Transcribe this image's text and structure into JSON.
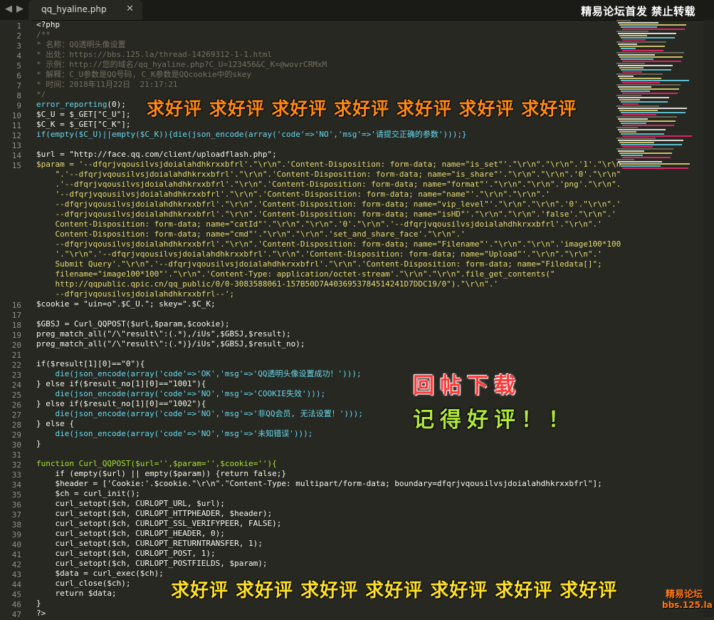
{
  "tabbar": {
    "back_icon": "◀",
    "forward_icon": "▶",
    "tab_title": "qq_hyaline.php",
    "close_icon": "✕"
  },
  "banner": "精易论坛首发 禁止转载",
  "gutter": [
    "1",
    "2",
    "3",
    "4",
    "5",
    "6",
    "7",
    "8",
    "9",
    "10",
    "11",
    "12",
    "13",
    "14",
    "15",
    "16",
    "17",
    "18",
    "19",
    "20",
    "21",
    "22",
    "23",
    "24",
    "25",
    "26",
    "27",
    "28",
    "29",
    "30",
    "31",
    "32",
    "33",
    "34",
    "35",
    "36",
    "37",
    "38",
    "39",
    "40",
    "41",
    "42",
    "43",
    "44",
    "45",
    "46",
    "47"
  ],
  "code": {
    "l1": "<?php",
    "l2": "/**",
    "l3": "* 名称：QQ透明头像设置",
    "l4": "* 出处：https://bbs.125.la/thread-14269312-1-1.html",
    "l5": "* 示例：http://您的域名/qq_hyaline.php?C_U=123456&C_K=@wovrCRMxM",
    "l6": "* 解释：C_U参数是QQ号码, C_K参数是QQcookie中的skey",
    "l7": "* 时间：2018年11月22日  21:17:21",
    "l8": "*/",
    "l9_fn": "error_reporting",
    "l9_rest": "(0);",
    "l10": "$C_U = $_GET[\"C_U\"];",
    "l11": "$C_K = $_GET[\"C_K\"];",
    "l12a": "if(empty($C_U)||empty($C_K)){die(json_encode(array('code'=>'NO','msg'=>'请提交正确的参数')));}",
    "l14": "$url = \"http://face.qq.com/client/uploadflash.php\";",
    "l15_1": "$param = '--dfqrjvqousilvsjdoialahdhkrxxbfrl'.\"\\r\\n\".'Content-Disposition: form-data; name=\"is_set\"'.\"\\r\\n\".\"\\r\\n\".'1'.\"\\r\\n",
    "l15_2": "    \".'--dfqrjvqousilvsjdoialahdhkrxxbfrl'.\"\\r\\n\".'Content-Disposition: form-data; name=\"is_share\"'.\"\\r\\n\".\"\\r\\n\".'0'.\"\\r\\n\"",
    "l15_3": "    .'--dfqrjvqousilvsjdoialahdhkrxxbfrl'.\"\\r\\n\".'Content-Disposition: form-data; name=\"format\"'.\"\\r\\n\".\"\\r\\n\".'png'.\"\\r\\n\".",
    "l15_4": "    '--dfqrjvqousilvsjdoialahdhkrxxbfrl'.\"\\r\\n\".'Content-Disposition: form-data; name=\"name\"'.\"\\r\\n\".\"\\r\\n\".'",
    "l15_5": "    --dfqrjvqousilvsjdoialahdhkrxxbfrl'.\"\\r\\n\".'Content-Disposition: form-data; name=\"vip_level\"'.\"\\r\\n\".\"\\r\\n\".'0'.\"\\r\\n\".'",
    "l15_6": "    --dfqrjvqousilvsjdoialahdhkrxxbfrl'.\"\\r\\n\".'Content-Disposition: form-data; name=\"isHD\"'.\"\\r\\n\".\"\\r\\n\".'false'.\"\\r\\n\".'",
    "l15_7": "    Content-Disposition: form-data; name=\"catId\"'.\"\\r\\n\".\"\\r\\n\".'0'.\"\\r\\n\".'--dfqrjvqousilvsjdoialahdhkrxxbfrl'.\"\\r\\n\".'",
    "l15_8": "    Content-Disposition: form-data; name=\"cmd\"'.\"\\r\\n\".\"\\r\\n\".'set_and_share_face'.\"\\r\\n\".'",
    "l15_9": "    --dfqrjvqousilvsjdoialahdhkrxxbfrl'.\"\\r\\n\".'Content-Disposition: form-data; name=\"Filename\"'.\"\\r\\n\".\"\\r\\n\".'image100*100",
    "l15_10": "    '.\"\\r\\n\".'--dfqrjvqousilvsjdoialahdhkrxxbfrl'.\"\\r\\n\".'Content-Disposition: form-data; name=\"Upload\"'.\"\\r\\n\".\"\\r\\n\".'",
    "l15_11": "    Submit Query'.\"\\r\\n\".'--dfqrjvqousilvsjdoialahdhkrxxbfrl'.\"\\r\\n\".'Content-Disposition: form-data; name=\"Filedata[]\";",
    "l15_12": "    filename=\"image100*100\"'.\"\\r\\n\".'Content-Type: application/octet-stream'.\"\\r\\n\".\"\\r\\n\".file_get_contents(\"",
    "l15_13": "    http://qqpublic.qpic.cn/qq_public/0/0-3083588061-157B50D7A4036953784514241D7DDC19/0\").\"\\r\\n\".'",
    "l15_14": "    --dfqrjvqousilvsjdoialahdhkrxxbfrl--';",
    "l16": "$cookie = \"uin=o\".$C_U.\"; skey=\".$C_K;",
    "l18": "$GBSJ = Curl_QQPOST($url,$param,$cookie);",
    "l19": "preg_match_all(\"/\\\"result\\\":(.*),/iUs\",$GBSJ,$result);",
    "l20": "preg_match_all(\"/\\\"result\\\":(.*)}/iUs\",$GBSJ,$result_no);",
    "l22": "if($result[1][0]==\"0\"){",
    "l23": "    die(json_encode(array('code'=>'OK','msg'=>'QQ透明头像设置成功！')));",
    "l24": "} else if($result_no[1][0]==\"1001\"){",
    "l25": "    die(json_encode(array('code'=>'NO','msg'=>'COOKIE失效')));",
    "l26": "} else if($result_no[1][0]==\"1002\"){",
    "l27": "    die(json_encode(array('code'=>'NO','msg'=>'非QQ会员, 无法设置！')));",
    "l28": "} else {",
    "l29": "    die(json_encode(array('code'=>'NO','msg'=>'未知错误')));",
    "l30": "}",
    "l32": "function Curl_QQPOST($url='',$param='',$cookie=''){",
    "l33": "    if (empty($url) || empty($param)) {return false;}",
    "l34": "    $header = ['Cookie:'.$cookie.\"\\r\\n\".\"Content-Type: multipart/form-data; boundary=dfqrjvqousilvsjdoialahdhkrxxbfrl\"];",
    "l35": "    $ch = curl_init();",
    "l36": "    curl_setopt($ch, CURLOPT_URL, $url);",
    "l37": "    curl_setopt($ch, CURLOPT_HTTPHEADER, $header);",
    "l38": "    curl_setopt($ch, CURLOPT_SSL_VERIFYPEER, FALSE);",
    "l39": "    curl_setopt($ch, CURLOPT_HEADER, 0);",
    "l40": "    curl_setopt($ch, CURLOPT_RETURNTRANSFER, 1);",
    "l41": "    curl_setopt($ch, CURLOPT_POST, 1);",
    "l42": "    curl_setopt($ch, CURLOPT_POSTFIELDS, $param);",
    "l43": "    $data = curl_exec($ch);",
    "l44": "    curl_close($ch);",
    "l45": "    return $data;",
    "l46": "}",
    "l47": "?>"
  },
  "overlays": {
    "top": "求好评 求好评 求好评 求好评 求好评 求好评 求好评",
    "reply": "回帖下载",
    "remember": "记得好评！！",
    "bottom": "求好评 求好评 求好评 求好评 求好评 求好评 求好评"
  },
  "logo": {
    "line1": "精易论坛",
    "line2": "bbs.125.la"
  },
  "colors": {
    "background": "#272822",
    "comment": "#75715e",
    "keyword": "#f92672",
    "function": "#66d9ef",
    "string": "#e6db74",
    "number": "#ae81ff"
  }
}
